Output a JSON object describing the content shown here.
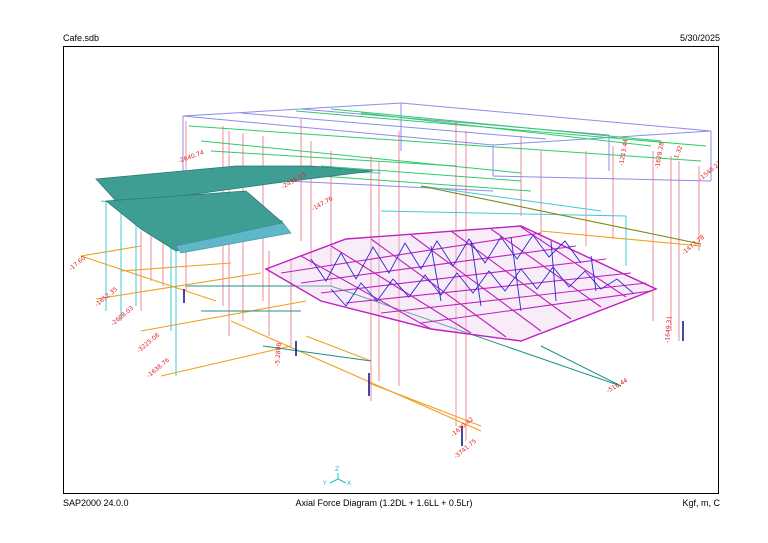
{
  "header": {
    "file_name": "Cafe.sdb",
    "date": "5/30/2025"
  },
  "footer": {
    "version": "SAP2000 24.0.0",
    "caption": "Axial Force Diagram (1.2DL + 1.6LL + 0.5Lr)",
    "units": "Kgf, m, C"
  },
  "axes": {
    "x": "X",
    "y": "Y",
    "z": "Z"
  },
  "force_labels": [
    "-1638.76",
    "-1473.78",
    "-1652.35",
    "-2608.03",
    "-3225.08",
    "-17.60",
    "-2640.74",
    "-5.2808",
    "-1649.31",
    "-3741.75",
    "-1630.42",
    "-1.32",
    "-2495.03",
    "-1213.44",
    "-1628.28",
    "-147.76",
    "-516.44",
    "-1546.23"
  ],
  "colors": {
    "wall_frame": "#8c8cf0",
    "roof_purlin": "#2ecc6a",
    "column": "#e8556a",
    "beam_orange": "#f0a020",
    "beam_teal": "#1f8f86",
    "beam_cyan": "#40c8d8",
    "beam_olive": "#7a8a10",
    "truss": "#c020c0",
    "truss_web": "#2a2ad0",
    "slab": "#3f9e93",
    "label_red": "#e02020",
    "label_blue": "#2020e0"
  }
}
